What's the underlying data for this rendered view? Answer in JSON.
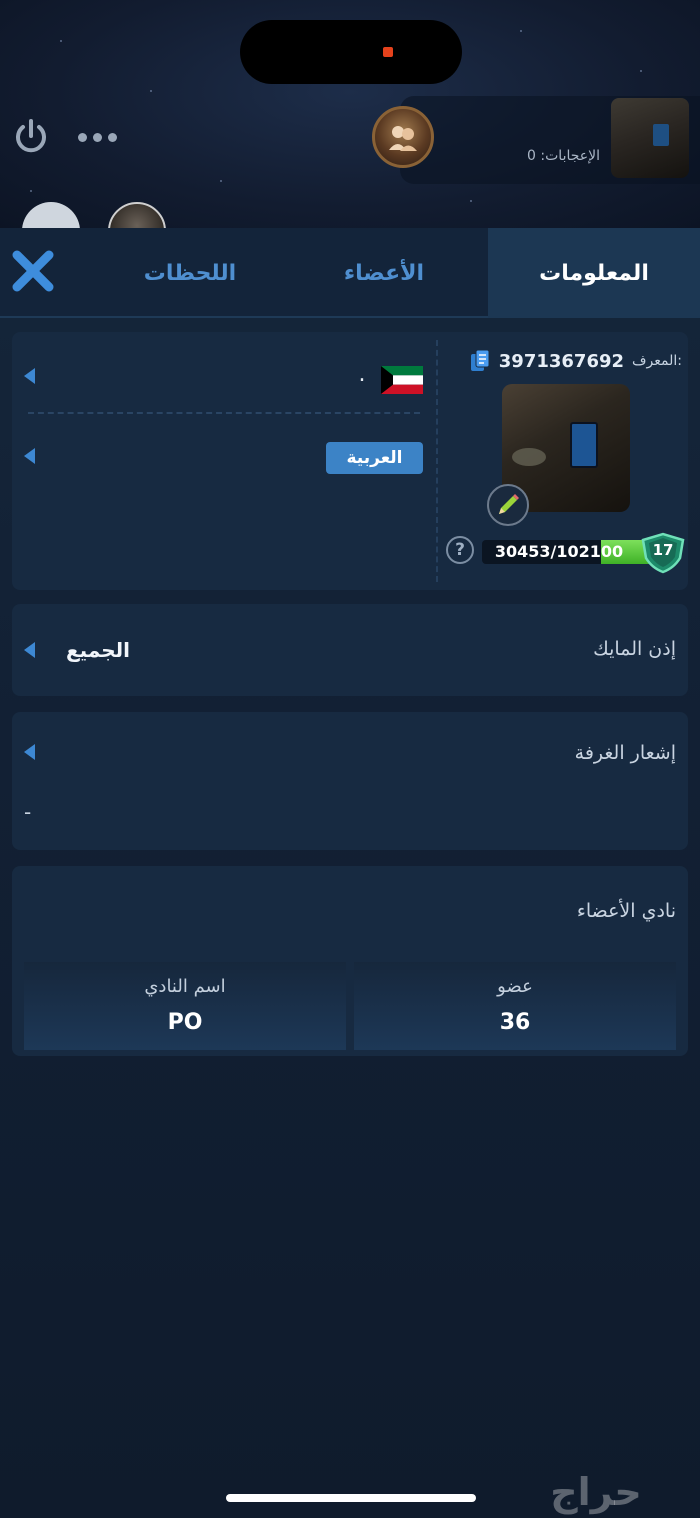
{
  "header": {
    "likes_label": "الإعجابات: 0"
  },
  "tabs": [
    {
      "label": "المعلومات",
      "active": true
    },
    {
      "label": "الأعضاء",
      "active": false
    },
    {
      "label": "اللحظات",
      "active": false
    }
  ],
  "info": {
    "id_label": "المعرف:",
    "id_value": "3971367692",
    "country_name": ".",
    "language": "العربية",
    "xp_value": "30453/102100",
    "xp_progress": 0.298,
    "level": "17"
  },
  "mic_permission": {
    "label": "إذن المايك",
    "value": "الجميع"
  },
  "room_notification": {
    "label": "إشعار الغرفة",
    "value": "-"
  },
  "club": {
    "title": "نادي الأعضاء",
    "members_label": "عضو",
    "members_value": "36",
    "name_label": "اسم النادي",
    "name_value": "PO"
  },
  "watermark": "حراج",
  "colors": {
    "accent_blue": "#3c83c6",
    "tab_inactive": "#4f8fd0",
    "xp_green": "#3fb127"
  }
}
